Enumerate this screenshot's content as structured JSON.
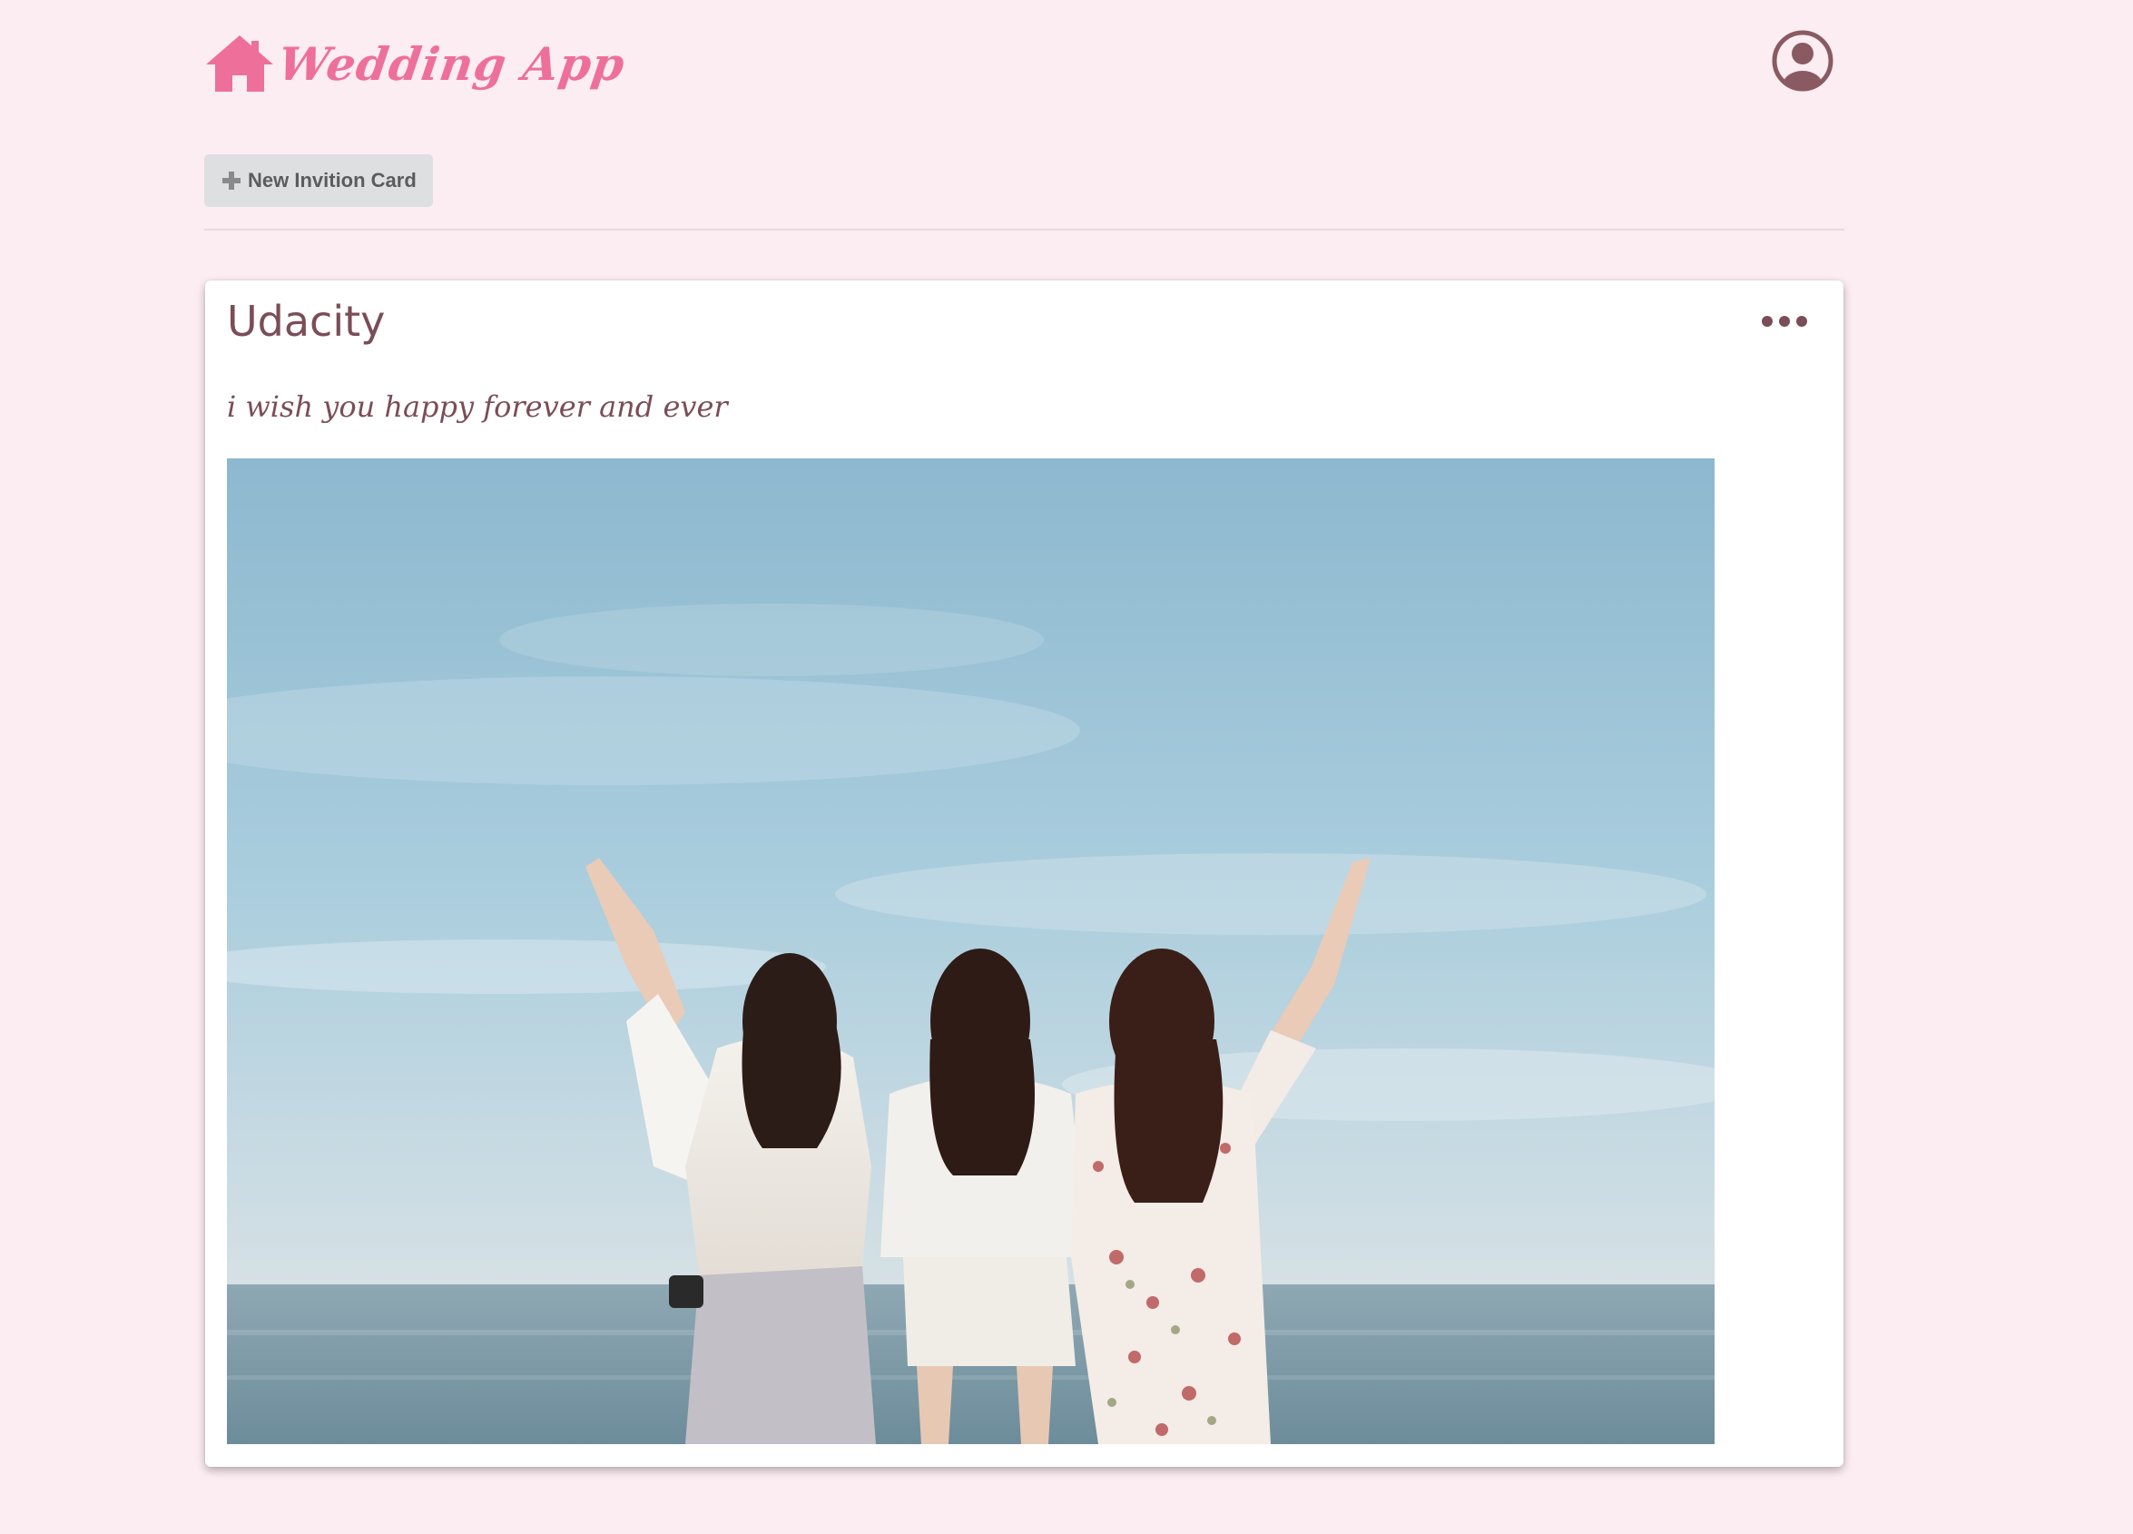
{
  "header": {
    "brand_name": "Wedding App",
    "home_icon": "home-icon",
    "user_icon": "user-circle-icon"
  },
  "toolbar": {
    "new_card_label": "New Invition Card",
    "new_card_icon": "plus-icon"
  },
  "card": {
    "title": "Udacity",
    "message": "i wish you happy forever and ever",
    "menu_icon": "ellipsis-icon",
    "photo": "three women on a beach raising their arms toward the sea"
  },
  "colors": {
    "background": "#fbedf2",
    "brand": "#ee6f9a",
    "text_accent": "#7b4d57",
    "button_bg": "#dedfe0",
    "card_bg": "#ffffff"
  }
}
